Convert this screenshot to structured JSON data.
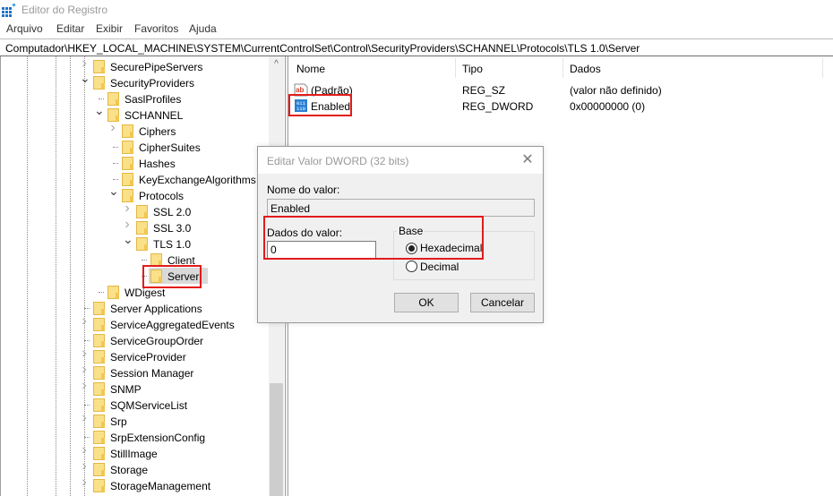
{
  "window": {
    "title": "Editor do Registro"
  },
  "menu": [
    "Arquivo",
    "Editar",
    "Exibir",
    "Favoritos",
    "Ajuda"
  ],
  "address": {
    "path": "Computador\\HKEY_LOCAL_MACHINE\\SYSTEM\\CurrentControlSet\\Control\\SecurityProviders\\SCHANNEL\\Protocols\\TLS 1.0\\Server"
  },
  "tree": {
    "items": [
      {
        "label": "SecurePipeServers",
        "level": 0,
        "expander": "collapsed"
      },
      {
        "label": "SecurityProviders",
        "level": 0,
        "expander": "expanded"
      },
      {
        "label": "SaslProfiles",
        "level": 1,
        "expander": "none"
      },
      {
        "label": "SCHANNEL",
        "level": 1,
        "expander": "expanded"
      },
      {
        "label": "Ciphers",
        "level": 2,
        "expander": "collapsed"
      },
      {
        "label": "CipherSuites",
        "level": 2,
        "expander": "none"
      },
      {
        "label": "Hashes",
        "level": 2,
        "expander": "none"
      },
      {
        "label": "KeyExchangeAlgorithms",
        "level": 2,
        "expander": "none"
      },
      {
        "label": "Protocols",
        "level": 2,
        "expander": "expanded"
      },
      {
        "label": "SSL 2.0",
        "level": 3,
        "expander": "collapsed"
      },
      {
        "label": "SSL 3.0",
        "level": 3,
        "expander": "collapsed"
      },
      {
        "label": "TLS 1.0",
        "level": 3,
        "expander": "expanded"
      },
      {
        "label": "Client",
        "level": 4,
        "expander": "none"
      },
      {
        "label": "Server",
        "level": 4,
        "expander": "none",
        "selected": true,
        "highlighted": true
      },
      {
        "label": "WDigest",
        "level": 1,
        "expander": "none"
      },
      {
        "label": "Server Applications",
        "level": 0,
        "expander": "none"
      },
      {
        "label": "ServiceAggregatedEvents",
        "level": 0,
        "expander": "collapsed"
      },
      {
        "label": "ServiceGroupOrder",
        "level": 0,
        "expander": "none"
      },
      {
        "label": "ServiceProvider",
        "level": 0,
        "expander": "collapsed"
      },
      {
        "label": "Session Manager",
        "level": 0,
        "expander": "collapsed"
      },
      {
        "label": "SNMP",
        "level": 0,
        "expander": "collapsed"
      },
      {
        "label": "SQMServiceList",
        "level": 0,
        "expander": "none"
      },
      {
        "label": "Srp",
        "level": 0,
        "expander": "collapsed"
      },
      {
        "label": "SrpExtensionConfig",
        "level": 0,
        "expander": "none"
      },
      {
        "label": "StillImage",
        "level": 0,
        "expander": "collapsed"
      },
      {
        "label": "Storage",
        "level": 0,
        "expander": "collapsed"
      },
      {
        "label": "StorageManagement",
        "level": 0,
        "expander": "collapsed"
      }
    ]
  },
  "list": {
    "columns": [
      "Nome",
      "Tipo",
      "Dados"
    ],
    "rows": [
      {
        "icon": "string-value-icon",
        "name": "(Padrão)",
        "type": "REG_SZ",
        "data": "(valor não definido)"
      },
      {
        "icon": "binary-value-icon",
        "name": "Enabled",
        "type": "REG_DWORD",
        "data": "0x00000000 (0)",
        "highlighted": true
      }
    ]
  },
  "dialog": {
    "title": "Editar Valor DWORD (32 bits)",
    "value_name_label": "Nome do valor:",
    "value_name": "Enabled",
    "value_data_label": "Dados do valor:",
    "value_data": "0",
    "base_label": "Base",
    "base_options": [
      {
        "label": "Hexadecimal",
        "checked": true
      },
      {
        "label": "Decimal",
        "checked": false
      }
    ],
    "ok_label": "OK",
    "cancel_label": "Cancelar"
  },
  "colors": {
    "highlight_box": "#e31b1b",
    "folder": "#f8d775",
    "selection": "#d9d9d9"
  }
}
